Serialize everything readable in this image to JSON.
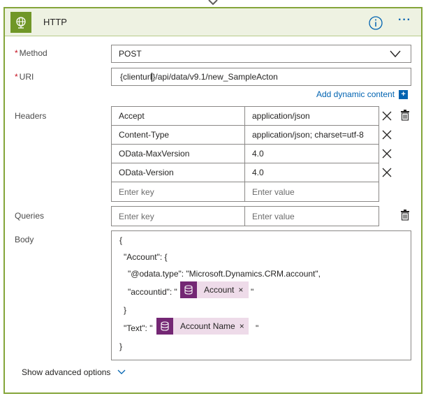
{
  "header": {
    "title": "HTTP"
  },
  "method": {
    "label": "Method",
    "required_mark": "*",
    "value": "POST"
  },
  "uri": {
    "label": "URI",
    "required_mark": "*",
    "value_before_cursor": "{clienturl",
    "value_after_cursor": "}/api/data/v9.1/new_SampleActon"
  },
  "add_dynamic_content": "Add dynamic content",
  "add_dynamic_plus": "+",
  "headers": {
    "label": "Headers",
    "rows": [
      {
        "key": "Accept",
        "value": "application/json"
      },
      {
        "key": "Content-Type",
        "value": "application/json; charset=utf-8"
      },
      {
        "key": "OData-MaxVersion",
        "value": "4.0"
      },
      {
        "key": "OData-Version",
        "value": "4.0"
      }
    ],
    "key_placeholder": "Enter key",
    "value_placeholder": "Enter value"
  },
  "queries": {
    "label": "Queries",
    "key_placeholder": "Enter key",
    "value_placeholder": "Enter value"
  },
  "body": {
    "label": "Body",
    "lines": [
      "{",
      "\"Account\": {",
      "\"@odata.type\": \"Microsoft.Dynamics.CRM.account\",",
      "\"accountid\": \"",
      "\"",
      "}",
      "\"Text\": \"",
      "\"",
      "}"
    ],
    "token_account": "Account",
    "token_account_name": "Account Name",
    "token_remove": "×"
  },
  "advanced": {
    "label": "Show advanced options"
  },
  "colors": {
    "card_border": "#84a53a",
    "header_bg": "#eef2e2",
    "connector_icon": "#709727",
    "link": "#0063b1",
    "token_bg": "#eedbe9",
    "token_icon": "#742774",
    "required": "#c50f1f"
  },
  "icons": {
    "connector": "globe-icon",
    "info": "info-icon",
    "more": "more-icon",
    "dropdown": "chevron-down-icon",
    "remove_row": "close-icon",
    "switch_mode": "table-text-toggle-icon",
    "token": "dataverse-icon"
  }
}
